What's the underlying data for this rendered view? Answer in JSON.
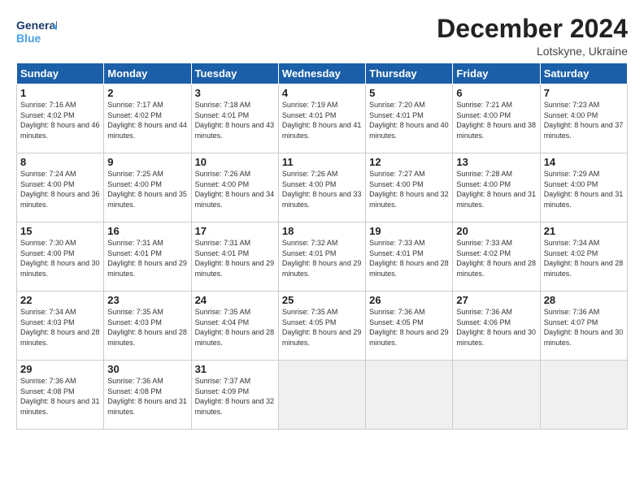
{
  "header": {
    "logo_line1": "General",
    "logo_line2": "Blue",
    "month_title": "December 2024",
    "location": "Lotskyne, Ukraine"
  },
  "weekdays": [
    "Sunday",
    "Monday",
    "Tuesday",
    "Wednesday",
    "Thursday",
    "Friday",
    "Saturday"
  ],
  "weeks": [
    [
      {
        "day": "1",
        "sunrise": "7:16 AM",
        "sunset": "4:02 PM",
        "daylight": "8 hours and 46 minutes."
      },
      {
        "day": "2",
        "sunrise": "7:17 AM",
        "sunset": "4:02 PM",
        "daylight": "8 hours and 44 minutes."
      },
      {
        "day": "3",
        "sunrise": "7:18 AM",
        "sunset": "4:01 PM",
        "daylight": "8 hours and 43 minutes."
      },
      {
        "day": "4",
        "sunrise": "7:19 AM",
        "sunset": "4:01 PM",
        "daylight": "8 hours and 41 minutes."
      },
      {
        "day": "5",
        "sunrise": "7:20 AM",
        "sunset": "4:01 PM",
        "daylight": "8 hours and 40 minutes."
      },
      {
        "day": "6",
        "sunrise": "7:21 AM",
        "sunset": "4:00 PM",
        "daylight": "8 hours and 38 minutes."
      },
      {
        "day": "7",
        "sunrise": "7:23 AM",
        "sunset": "4:00 PM",
        "daylight": "8 hours and 37 minutes."
      }
    ],
    [
      {
        "day": "8",
        "sunrise": "7:24 AM",
        "sunset": "4:00 PM",
        "daylight": "8 hours and 36 minutes."
      },
      {
        "day": "9",
        "sunrise": "7:25 AM",
        "sunset": "4:00 PM",
        "daylight": "8 hours and 35 minutes."
      },
      {
        "day": "10",
        "sunrise": "7:26 AM",
        "sunset": "4:00 PM",
        "daylight": "8 hours and 34 minutes."
      },
      {
        "day": "11",
        "sunrise": "7:26 AM",
        "sunset": "4:00 PM",
        "daylight": "8 hours and 33 minutes."
      },
      {
        "day": "12",
        "sunrise": "7:27 AM",
        "sunset": "4:00 PM",
        "daylight": "8 hours and 32 minutes."
      },
      {
        "day": "13",
        "sunrise": "7:28 AM",
        "sunset": "4:00 PM",
        "daylight": "8 hours and 31 minutes."
      },
      {
        "day": "14",
        "sunrise": "7:29 AM",
        "sunset": "4:00 PM",
        "daylight": "8 hours and 31 minutes."
      }
    ],
    [
      {
        "day": "15",
        "sunrise": "7:30 AM",
        "sunset": "4:00 PM",
        "daylight": "8 hours and 30 minutes."
      },
      {
        "day": "16",
        "sunrise": "7:31 AM",
        "sunset": "4:01 PM",
        "daylight": "8 hours and 29 minutes."
      },
      {
        "day": "17",
        "sunrise": "7:31 AM",
        "sunset": "4:01 PM",
        "daylight": "8 hours and 29 minutes."
      },
      {
        "day": "18",
        "sunrise": "7:32 AM",
        "sunset": "4:01 PM",
        "daylight": "8 hours and 29 minutes."
      },
      {
        "day": "19",
        "sunrise": "7:33 AM",
        "sunset": "4:01 PM",
        "daylight": "8 hours and 28 minutes."
      },
      {
        "day": "20",
        "sunrise": "7:33 AM",
        "sunset": "4:02 PM",
        "daylight": "8 hours and 28 minutes."
      },
      {
        "day": "21",
        "sunrise": "7:34 AM",
        "sunset": "4:02 PM",
        "daylight": "8 hours and 28 minutes."
      }
    ],
    [
      {
        "day": "22",
        "sunrise": "7:34 AM",
        "sunset": "4:03 PM",
        "daylight": "8 hours and 28 minutes."
      },
      {
        "day": "23",
        "sunrise": "7:35 AM",
        "sunset": "4:03 PM",
        "daylight": "8 hours and 28 minutes."
      },
      {
        "day": "24",
        "sunrise": "7:35 AM",
        "sunset": "4:04 PM",
        "daylight": "8 hours and 28 minutes."
      },
      {
        "day": "25",
        "sunrise": "7:35 AM",
        "sunset": "4:05 PM",
        "daylight": "8 hours and 29 minutes."
      },
      {
        "day": "26",
        "sunrise": "7:36 AM",
        "sunset": "4:05 PM",
        "daylight": "8 hours and 29 minutes."
      },
      {
        "day": "27",
        "sunrise": "7:36 AM",
        "sunset": "4:06 PM",
        "daylight": "8 hours and 30 minutes."
      },
      {
        "day": "28",
        "sunrise": "7:36 AM",
        "sunset": "4:07 PM",
        "daylight": "8 hours and 30 minutes."
      }
    ],
    [
      {
        "day": "29",
        "sunrise": "7:36 AM",
        "sunset": "4:08 PM",
        "daylight": "8 hours and 31 minutes."
      },
      {
        "day": "30",
        "sunrise": "7:36 AM",
        "sunset": "4:08 PM",
        "daylight": "8 hours and 31 minutes."
      },
      {
        "day": "31",
        "sunrise": "7:37 AM",
        "sunset": "4:09 PM",
        "daylight": "8 hours and 32 minutes."
      },
      null,
      null,
      null,
      null
    ]
  ]
}
